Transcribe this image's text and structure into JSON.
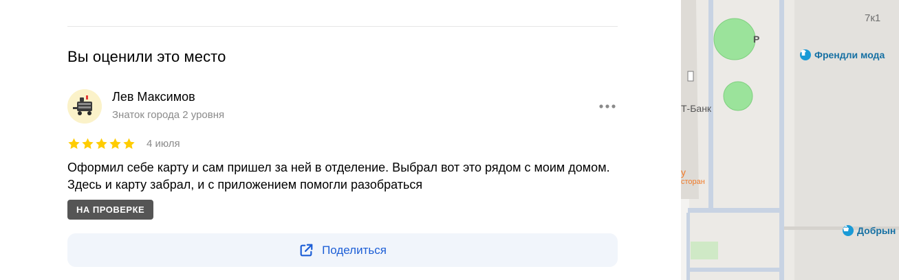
{
  "review_section": {
    "title": "Вы оценили это место"
  },
  "review": {
    "author_name": "Лев Максимов",
    "author_level": "Знаток города 2 уровня",
    "rating": 5,
    "rating_max": 5,
    "date": "4 июля",
    "text": "Оформил себе карту и сам пришел за ней в отделение. Выбрал вот это рядом с моим домом. Здесь и карту забрал, и с приложением помогли разобраться",
    "status": "НА ПРОВЕРКЕ",
    "more_icon": "more-horizontal-icon"
  },
  "share": {
    "label": "Поделиться",
    "icon": "share-external-icon"
  },
  "map": {
    "building_number": "7к1",
    "poi_fashion": "Френдли мода",
    "poi_fashion_icon": "tshirt-icon",
    "poi_store": "Добрын",
    "poi_store_icon": "basket-icon",
    "bank_label": "Т-Банк",
    "restaurant_label": "сторан",
    "restaurant_label_prefix": "у",
    "letter_p": "Р"
  },
  "colors": {
    "star": "#ffcc00",
    "badge_bg": "#555555",
    "share_bg": "#f1f5fb",
    "share_text": "#1c5ed6",
    "secondary_text": "#8a8a8a",
    "map_bg": "#eceae6",
    "map_road": "#c8d3e3",
    "map_tree": "#9be39b",
    "map_poi": "#1670a3",
    "map_restaurant": "#f07a28"
  }
}
